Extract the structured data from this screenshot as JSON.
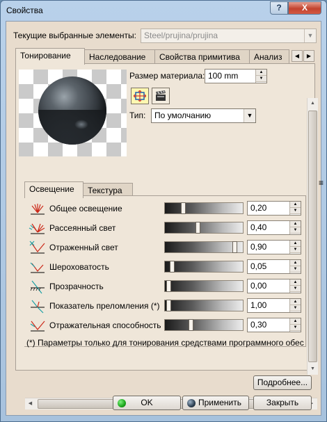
{
  "window": {
    "title": "Свойства",
    "help_label": "?",
    "close_label": "X"
  },
  "selection": {
    "label": "Текущие выбранные элементы:",
    "value": "Steel/prujina/prujina"
  },
  "tabs": [
    {
      "label": "Тонирование",
      "active": true
    },
    {
      "label": "Наследование",
      "active": false
    },
    {
      "label": "Свойства примитива",
      "active": false
    },
    {
      "label": "Анализ",
      "active": false
    }
  ],
  "material": {
    "size_label": "Размер материала:",
    "size_value": "100 mm",
    "type_label": "Тип:",
    "type_value": "По умолчанию",
    "icons": [
      "fit-mapping-icon",
      "clapperboard-icon"
    ]
  },
  "inner_tabs": [
    {
      "label": "Освещение",
      "active": true
    },
    {
      "label": "Текстура",
      "active": false
    }
  ],
  "lighting_params": [
    {
      "label": "Общее освещение",
      "value": "0,20",
      "level": 0.2,
      "icon": "ambient-light-icon"
    },
    {
      "label": "Рассеянный свет",
      "value": "0,40",
      "level": 0.4,
      "icon": "diffuse-light-icon"
    },
    {
      "label": "Отраженный свет",
      "value": "0,90",
      "level": 0.9,
      "icon": "specular-light-icon"
    },
    {
      "label": "Шероховатость",
      "value": "0,05",
      "level": 0.05,
      "icon": "roughness-icon"
    },
    {
      "label": "Прозрачность",
      "value": "0,00",
      "level": 0.0,
      "icon": "transparency-icon"
    },
    {
      "label": "Показатель преломления (*)",
      "value": "1,00",
      "level": 0.0,
      "icon": "refraction-index-icon"
    },
    {
      "label": "Отражательная способность",
      "value": "0,30",
      "level": 0.3,
      "icon": "reflectivity-icon"
    }
  ],
  "note": "(*) Параметры только для тонирования средствами программного обес",
  "buttons": {
    "more": "Подробнее...",
    "ok": "OK",
    "apply": "Применить",
    "close": "Закрыть"
  },
  "colors": {
    "ok_indicator": "#1aa51a",
    "apply_indicator": "#2c3f52",
    "light_icon_red": "#cc2a1a",
    "light_icon_teal": "#1aa0a5"
  }
}
